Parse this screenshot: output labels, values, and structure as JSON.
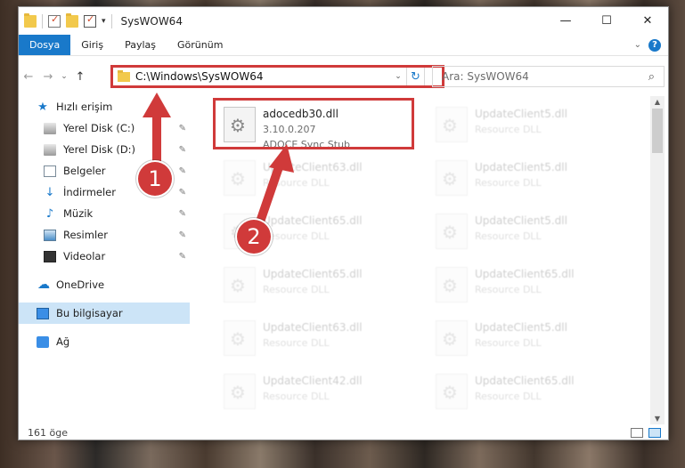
{
  "titlebar": {
    "title": "SysWOW64",
    "minimize": "—",
    "maximize": "☐",
    "close": "✕"
  },
  "ribbon": {
    "tabs": [
      "Dosya",
      "Giriş",
      "Paylaş",
      "Görünüm"
    ],
    "expand": "⌄",
    "help": "?"
  },
  "address": {
    "back": "←",
    "forward": "→",
    "recent": "⌄",
    "up": "↑",
    "path": "C:\\Windows\\SysWOW64",
    "dropdown": "⌄",
    "refresh": "↻",
    "search_placeholder": "Ara: SysWOW64",
    "search_icon": "⌕"
  },
  "nav": {
    "quick_access": "Hızlı erişim",
    "items": [
      {
        "label": "Yerel Disk (C:)",
        "icon": "disk-icon"
      },
      {
        "label": "Yerel Disk (D:)",
        "icon": "disk-icon"
      },
      {
        "label": "Belgeler",
        "icon": "documents-icon"
      },
      {
        "label": "İndirmeler",
        "icon": "download-icon"
      },
      {
        "label": "Müzik",
        "icon": "music-icon"
      },
      {
        "label": "Resimler",
        "icon": "pictures-icon"
      },
      {
        "label": "Videolar",
        "icon": "videos-icon"
      }
    ],
    "onedrive": "OneDrive",
    "this_pc": "Bu bilgisayar",
    "network": "Ağ",
    "pin": "📌"
  },
  "files": {
    "highlighted": {
      "name": "adocedb30.dll",
      "version": "3.10.0.207",
      "description": "ADOCE Sync Stub"
    },
    "background": [
      {
        "name": "UpdateClient5.dll",
        "description": "Resource DLL"
      },
      {
        "name": "UpdateClient63.dll",
        "description": "Resource DLL"
      },
      {
        "name": "UpdateClient5.dll",
        "description": "Resource DLL"
      },
      {
        "name": "UpdateClient65.dll",
        "description": "Resource DLL"
      },
      {
        "name": "UpdateClient5.dll",
        "description": "Resource DLL"
      },
      {
        "name": "UpdateClient65.dll",
        "description": "Resource DLL"
      },
      {
        "name": "UpdateClient65.dll",
        "description": "Resource DLL"
      },
      {
        "name": "UpdateClient63.dll",
        "description": "Resource DLL"
      },
      {
        "name": "UpdateClient5.dll",
        "description": "Resource DLL"
      },
      {
        "name": "UpdateClient42.dll",
        "description": "Resource DLL"
      },
      {
        "name": "UpdateClient65.dll",
        "description": "Resource DLL"
      }
    ]
  },
  "status": {
    "count": "161 öge"
  },
  "annotations": {
    "step1": "1",
    "step2": "2",
    "color": "#d03a3a"
  }
}
